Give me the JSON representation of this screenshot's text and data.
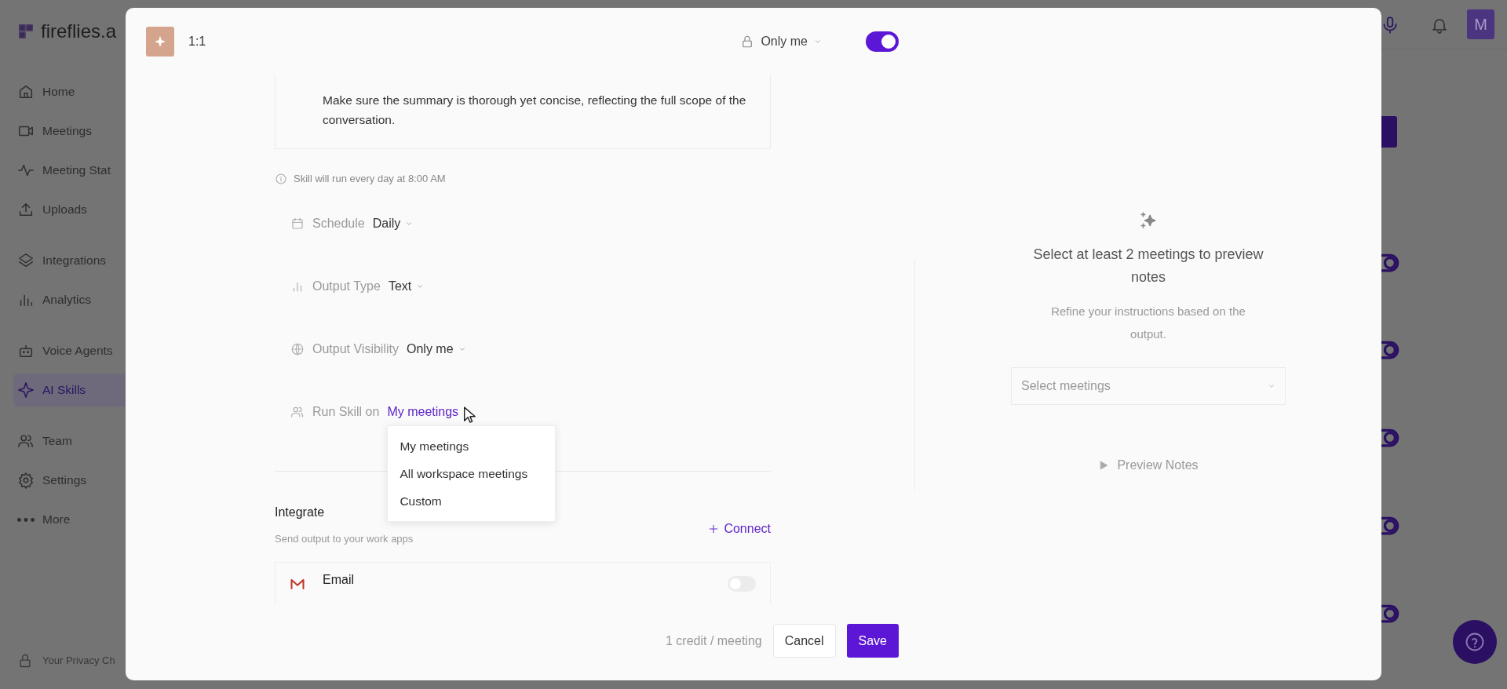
{
  "app": {
    "logo_text": "fireflies.a",
    "sidebar": {
      "sections": [
        {
          "items": [
            {
              "kind": "home",
              "label": "Home",
              "selected": false
            },
            {
              "kind": "video",
              "label": "Meetings",
              "selected": false
            },
            {
              "kind": "pulse",
              "label": "Meeting Stat",
              "selected": false
            },
            {
              "kind": "upload",
              "label": "Uploads",
              "selected": false
            }
          ]
        },
        {
          "items": [
            {
              "kind": "layers",
              "label": "Integrations",
              "selected": false
            },
            {
              "kind": "bars",
              "label": "Analytics",
              "selected": false
            }
          ]
        },
        {
          "items": [
            {
              "kind": "robot",
              "label": "Voice Agents",
              "selected": false
            },
            {
              "kind": "sparkle",
              "label": "AI Skills",
              "selected": true
            }
          ]
        },
        {
          "items": [
            {
              "kind": "people",
              "label": "Team",
              "selected": false
            },
            {
              "kind": "gear",
              "label": "Settings",
              "selected": false
            },
            {
              "kind": "dots",
              "label": "More",
              "selected": false
            }
          ]
        }
      ],
      "footer": "Your Privacy Ch"
    },
    "avatar": "M"
  },
  "modal": {
    "skill_name": "1:1",
    "visibility": "Only me",
    "enabled": true,
    "instructions": "Make sure the summary is thorough yet concise, reflecting the full scope of the conversation.",
    "schedule_note": "Skill will run every day at 8:00 AM",
    "settings": [
      {
        "kind": "calendar",
        "label": "Schedule",
        "value": "Daily",
        "expanded": false
      },
      {
        "kind": "chart",
        "label": "Output Type",
        "value": "Text",
        "expanded": false
      },
      {
        "kind": "globe",
        "label": "Output Visibility",
        "value": "Only me",
        "expanded": false
      },
      {
        "kind": "people",
        "label": "Run Skill on",
        "value": "My meetings",
        "expanded": true
      }
    ],
    "dropdown": {
      "options": [
        "My meetings",
        "All workspace meetings",
        "Custom"
      ]
    },
    "integrate": {
      "title": "Integrate",
      "subtitle": "Send output to your work apps",
      "connect": "Connect"
    },
    "integrations": [
      {
        "name": "Email",
        "on": false
      }
    ],
    "footer": {
      "credits": "1 credit / meeting",
      "cancel": "Cancel",
      "save": "Save"
    },
    "preview": {
      "title": "Select at least 2 meetings to preview notes",
      "subtitle": "Refine your instructions based on the output.",
      "select_placeholder": "Select meetings",
      "button": "Preview Notes"
    }
  }
}
